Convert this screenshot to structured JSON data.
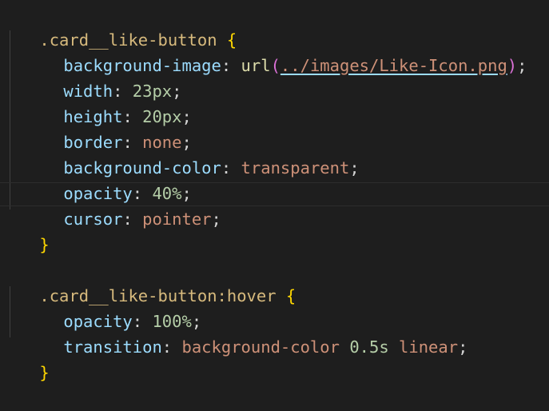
{
  "code": {
    "line1": {
      "selector": ".card__like-button",
      "open": " {"
    },
    "line2": {
      "prop": "background-image",
      "colon": ": ",
      "fn": "url",
      "lp": "(",
      "arg": "../images/Like-Icon.png",
      "rp": ")",
      "semi": ";"
    },
    "line3": {
      "prop": "width",
      "colon": ": ",
      "value": "23px",
      "semi": ";"
    },
    "line4": {
      "prop": "height",
      "colon": ": ",
      "value": "20px",
      "semi": ";"
    },
    "line5": {
      "prop": "border",
      "colon": ": ",
      "value": "none",
      "semi": ";"
    },
    "line6": {
      "prop": "background-color",
      "colon": ": ",
      "value": "transparent",
      "semi": ";"
    },
    "line7": {
      "prop": "opacity",
      "colon": ": ",
      "value": "40%",
      "semi": ";"
    },
    "line8": {
      "prop": "cursor",
      "colon": ": ",
      "value": "pointer",
      "semi": ";"
    },
    "line9": {
      "close": "}"
    },
    "line11": {
      "selector": ".card__like-button:hover",
      "open": " {"
    },
    "line12": {
      "prop": "opacity",
      "colon": ": ",
      "value": "100%",
      "semi": ";"
    },
    "line13": {
      "prop": "transition",
      "colon": ": ",
      "value1": "background-color",
      "value2": "0.5s",
      "value3": "linear",
      "semi": ";"
    },
    "line14": {
      "close": "}"
    }
  },
  "colors": {
    "background": "#1e1e1e",
    "selector": "#d7ba7d",
    "property": "#9cdcfe",
    "string_value": "#ce9178",
    "number": "#b5cea8",
    "function": "#dcdcaa",
    "brace": "#ffd700",
    "paren": "#da70d6"
  }
}
